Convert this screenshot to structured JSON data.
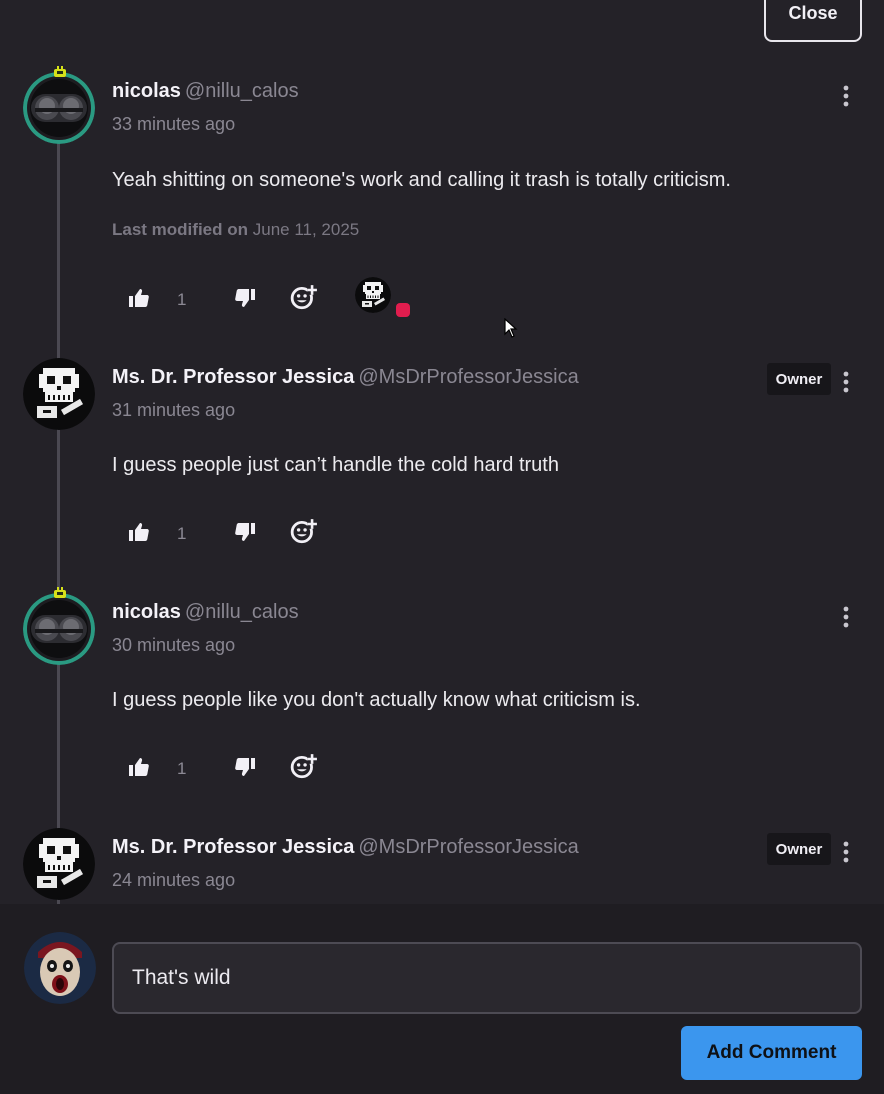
{
  "header": {
    "close_label": "Close"
  },
  "comments": [
    {
      "name": "nicolas",
      "handle": "@nillu_calos",
      "time": "33 minutes ago",
      "body": "Yeah shitting on someone's work and calling it trash is totally criticism.",
      "modified_label": "Last modified on",
      "modified_date": "June 11, 2025",
      "likes": "1",
      "avatar": "robot-avatar"
    },
    {
      "name": "Ms. Dr. Professor Jessica",
      "handle": "@MsDrProfessorJessica",
      "time": "31 minutes ago",
      "body": "I guess people just can’t handle the cold hard truth",
      "owner_badge": "Owner",
      "likes": "1",
      "avatar": "skeleton-avatar"
    },
    {
      "name": "nicolas",
      "handle": "@nillu_calos",
      "time": "30 minutes ago",
      "body": "I guess people like you don't actually know what criticism is.",
      "likes": "1",
      "avatar": "robot-avatar"
    },
    {
      "name": "Ms. Dr. Professor Jessica",
      "handle": "@MsDrProfessorJessica",
      "time": "24 minutes ago",
      "owner_badge": "Owner",
      "avatar": "skeleton-avatar"
    }
  ],
  "composer": {
    "input_value": "That's wild",
    "submit_label": "Add Comment",
    "avatar": "clown-avatar"
  },
  "colors": {
    "background": "#242228",
    "accent": "#3b96ee",
    "reaction_dot": "#e11d4e",
    "avatar_ring": "#2a9a82"
  }
}
